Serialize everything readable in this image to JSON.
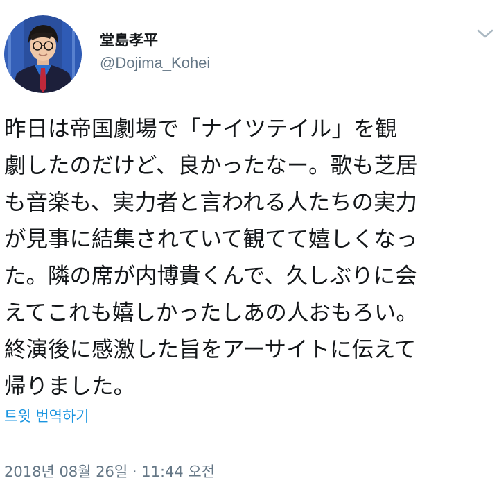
{
  "author": {
    "display_name": "堂島孝平",
    "handle": "@Dojima_Kohei",
    "avatar_icon": "profile-photo-avatar"
  },
  "menu": {
    "icon": "chevron-down-icon"
  },
  "tweet": {
    "text": "昨日は帝国劇場で「ナイツテイル」を観\n劇したのだけど、良かったなー。歌も芝居\nも音楽も、実力者と言われる人たちの実力\nが見事に結集されていて観てて嬉しくなっ\nた。隣の席が内博貴くんで、久しぶりに会\nえてこれも嬉しかったしあの人おもろい。\n終演後に感激した旨をアーサイトに伝えて\n帰りました。",
    "translate_label": "트윗 번역하기",
    "timestamp": "2018년 08월 26일 · 11:44 오전"
  },
  "colors": {
    "text_primary": "#14171a",
    "text_secondary": "#657786",
    "link": "#1b95e0",
    "caret": "#aab8c2"
  }
}
